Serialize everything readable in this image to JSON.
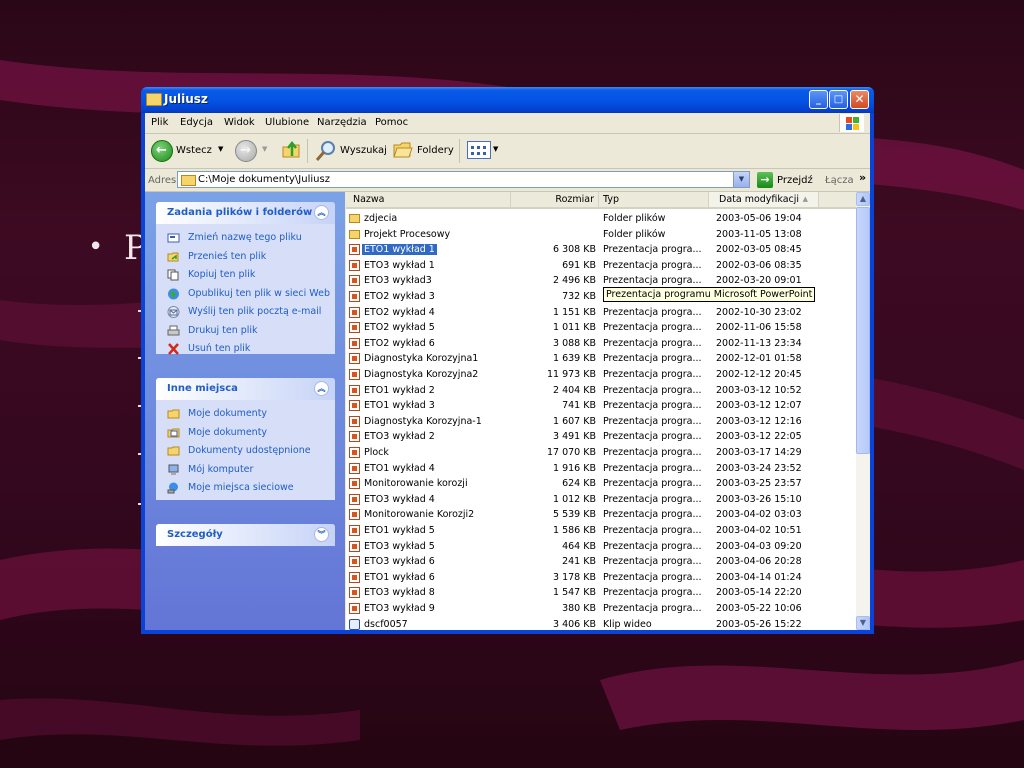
{
  "slide": {
    "bullet": "•",
    "letter": "P"
  },
  "window": {
    "title": "Juliusz"
  },
  "menu": [
    "Plik",
    "Edycja",
    "Widok",
    "Ulubione",
    "Narzędzia",
    "Pomoc"
  ],
  "toolbar": {
    "back": "Wstecz",
    "search": "Wyszukaj",
    "folders": "Foldery"
  },
  "address": {
    "label": "Adres",
    "value": "C:\\Moje dokumenty\\Juliusz",
    "go": "Przejdź",
    "links": "Łącza",
    "chevron": "»"
  },
  "tasks": {
    "title": "Zadania plików i folderów",
    "items": [
      {
        "label": "Zmień nazwę tego pliku",
        "icon": "rename-icon"
      },
      {
        "label": "Przenieś ten plik",
        "icon": "move-icon"
      },
      {
        "label": "Kopiuj ten plik",
        "icon": "copy-icon"
      },
      {
        "label": "Opublikuj ten plik w sieci Web",
        "icon": "globe-icon"
      },
      {
        "label": "Wyślij ten plik pocztą e-mail",
        "icon": "email-icon"
      },
      {
        "label": "Drukuj ten plik",
        "icon": "printer-icon"
      },
      {
        "label": "Usuń ten plik",
        "icon": "delete-icon"
      }
    ]
  },
  "places": {
    "title": "Inne miejsca",
    "items": [
      {
        "label": "Moje dokumenty",
        "icon": "folder-icon"
      },
      {
        "label": "Moje dokumenty",
        "icon": "documents-icon"
      },
      {
        "label": "Dokumenty udostępnione",
        "icon": "folder-icon"
      },
      {
        "label": "Mój komputer",
        "icon": "computer-icon"
      },
      {
        "label": "Moje miejsca sieciowe",
        "icon": "network-icon"
      }
    ]
  },
  "details": {
    "title": "Szczegóły"
  },
  "columns": {
    "name": "Nazwa",
    "size": "Rozmiar",
    "type": "Typ",
    "date": "Data modyfikacji"
  },
  "tooltip": "Prezentacja programu Microsoft PowerPoint",
  "files": [
    {
      "name": "zdjecia",
      "size": "",
      "type": "Folder plików",
      "date": "2003-05-06 19:04",
      "kind": "folder"
    },
    {
      "name": "Projekt Procesowy",
      "size": "",
      "type": "Folder plików",
      "date": "2003-11-05 13:08",
      "kind": "folder"
    },
    {
      "name": "ETO1 wykład 1",
      "size": "6 308 KB",
      "type": "Prezentacja progra...",
      "date": "2002-03-05 08:45",
      "kind": "ppt",
      "selected": true
    },
    {
      "name": "ETO3 wykład 1",
      "size": "691 KB",
      "type": "Prezentacja progra...",
      "date": "2002-03-06 08:35",
      "kind": "ppt"
    },
    {
      "name": "ETO3 wykład3",
      "size": "2 496 KB",
      "type": "Prezentacja progra...",
      "date": "2002-03-20 09:01",
      "kind": "ppt"
    },
    {
      "name": "ETO2 wykład 3",
      "size": "732 KB",
      "type": "",
      "date": "",
      "kind": "ppt"
    },
    {
      "name": "ETO2 wykład 4",
      "size": "1 151 KB",
      "type": "Prezentacja progra...",
      "date": "2002-10-30 23:02",
      "kind": "ppt"
    },
    {
      "name": "ETO2 wykład 5",
      "size": "1 011 KB",
      "type": "Prezentacja progra...",
      "date": "2002-11-06 15:58",
      "kind": "ppt"
    },
    {
      "name": "ETO2 wykład 6",
      "size": "3 088 KB",
      "type": "Prezentacja progra...",
      "date": "2002-11-13 23:34",
      "kind": "ppt"
    },
    {
      "name": "Diagnostyka Korozyjna1",
      "size": "1 639 KB",
      "type": "Prezentacja progra...",
      "date": "2002-12-01 01:58",
      "kind": "ppt"
    },
    {
      "name": "Diagnostyka Korozyjna2",
      "size": "11 973 KB",
      "type": "Prezentacja progra...",
      "date": "2002-12-12 20:45",
      "kind": "ppt"
    },
    {
      "name": "ETO1 wykład 2",
      "size": "2 404 KB",
      "type": "Prezentacja progra...",
      "date": "2003-03-12 10:52",
      "kind": "ppt"
    },
    {
      "name": "ETO1 wykład 3",
      "size": "741 KB",
      "type": "Prezentacja progra...",
      "date": "2003-03-12 12:07",
      "kind": "ppt"
    },
    {
      "name": "Diagnostyka Korozyjna-1",
      "size": "1 607 KB",
      "type": "Prezentacja progra...",
      "date": "2003-03-12 12:16",
      "kind": "ppt"
    },
    {
      "name": "ETO3 wykład 2",
      "size": "3 491 KB",
      "type": "Prezentacja progra...",
      "date": "2003-03-12 22:05",
      "kind": "ppt"
    },
    {
      "name": "Plock",
      "size": "17 070 KB",
      "type": "Prezentacja progra...",
      "date": "2003-03-17 14:29",
      "kind": "ppt"
    },
    {
      "name": "ETO1 wykład 4",
      "size": "1 916 KB",
      "type": "Prezentacja progra...",
      "date": "2003-03-24 23:52",
      "kind": "ppt"
    },
    {
      "name": "Monitorowanie korozji",
      "size": "624 KB",
      "type": "Prezentacja progra...",
      "date": "2003-03-25 23:57",
      "kind": "ppt"
    },
    {
      "name": "ETO3 wykład 4",
      "size": "1 012 KB",
      "type": "Prezentacja progra...",
      "date": "2003-03-26 15:10",
      "kind": "ppt"
    },
    {
      "name": "Monitorowanie Korozji2",
      "size": "5 539 KB",
      "type": "Prezentacja progra...",
      "date": "2003-04-02 03:03",
      "kind": "ppt"
    },
    {
      "name": "ETO1 wykład 5",
      "size": "1 586 KB",
      "type": "Prezentacja progra...",
      "date": "2003-04-02 10:51",
      "kind": "ppt"
    },
    {
      "name": "ETO3 wykład 5",
      "size": "464 KB",
      "type": "Prezentacja progra...",
      "date": "2003-04-03 09:20",
      "kind": "ppt"
    },
    {
      "name": "ETO3 wykład 6",
      "size": "241 KB",
      "type": "Prezentacja progra...",
      "date": "2003-04-06 20:28",
      "kind": "ppt"
    },
    {
      "name": "ETO1 wykład 6",
      "size": "3 178 KB",
      "type": "Prezentacja progra...",
      "date": "2003-04-14 01:24",
      "kind": "ppt"
    },
    {
      "name": "ETO3 wykład 8",
      "size": "1 547 KB",
      "type": "Prezentacja progra...",
      "date": "2003-05-14 22:20",
      "kind": "ppt"
    },
    {
      "name": "ETO3 wykład 9",
      "size": "380 KB",
      "type": "Prezentacja progra...",
      "date": "2003-05-22 10:06",
      "kind": "ppt"
    },
    {
      "name": "dscf0057",
      "size": "3 406 KB",
      "type": "Klip wideo",
      "date": "2003-05-26 15:22",
      "kind": "video"
    }
  ]
}
